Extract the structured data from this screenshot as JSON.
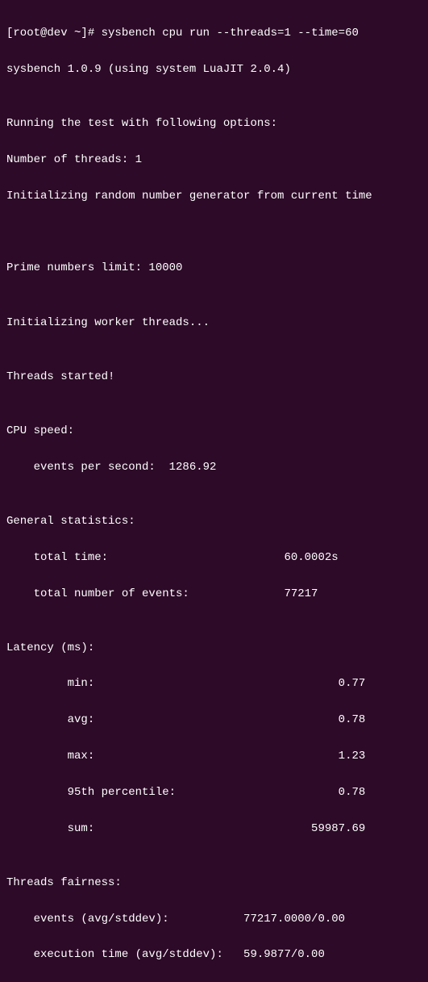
{
  "prompt": {
    "text": "[root@dev ~]# ",
    "command": "sysbench cpu run --threads=1 --time=60"
  },
  "output": {
    "version_line": "sysbench 1.0.9 (using system LuaJIT 2.0.4)",
    "blank1": "",
    "running_line": "Running the test with following options:",
    "threads_line": "Number of threads: 1",
    "rng_line": "Initializing random number generator from current time",
    "blank2": "",
    "blank3": "",
    "prime_line": "Prime numbers limit: 10000",
    "blank4": "",
    "init_workers": "Initializing worker threads...",
    "blank5": "",
    "threads_started": "Threads started!",
    "blank6": "",
    "cpu_speed_header": "CPU speed:",
    "events_per_sec": "    events per second:  1286.92",
    "blank7": "",
    "general_stats_header": "General statistics:",
    "total_time": "    total time:                          60.0002s",
    "total_events": "    total number of events:              77217",
    "blank8": "",
    "latency_header": "Latency (ms):",
    "lat_min": "         min:                                    0.77",
    "lat_avg": "         avg:                                    0.78",
    "lat_max": "         max:                                    1.23",
    "lat_95th": "         95th percentile:                        0.78",
    "lat_sum": "         sum:                                59987.69",
    "blank9": "",
    "fairness_header": "Threads fairness:",
    "fairness_events": "    events (avg/stddev):           77217.0000/0.00",
    "fairness_exec": "    execution time (avg/stddev):   59.9877/0.00"
  }
}
